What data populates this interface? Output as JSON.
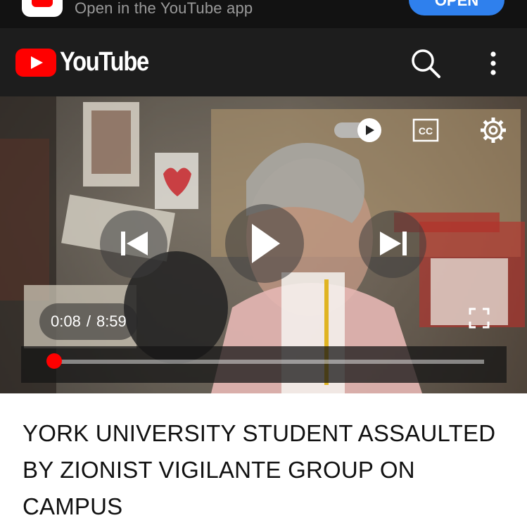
{
  "banner": {
    "text": "Open in the YouTube app",
    "open_label": "OPEN"
  },
  "header": {
    "logo_text": "YouTube"
  },
  "player": {
    "current_time": "0:08",
    "separator": "/",
    "duration": "8:59",
    "progress": 0.015
  },
  "video": {
    "title": "YORK UNIVERSITY STUDENT ASSAULTED BY ZIONIST VIGILANTE GROUP ON CAMPUS"
  },
  "colors": {
    "brand_red": "#ff0000",
    "open_blue": "#2f80ed",
    "header_bg": "#1d1d1d"
  },
  "icons": [
    "youtube-app-icon",
    "youtube-logo-icon",
    "search-icon",
    "more-icon",
    "autoplay-toggle-icon",
    "captions-icon",
    "gear-icon",
    "previous-icon",
    "play-icon",
    "next-icon",
    "fullscreen-icon"
  ]
}
